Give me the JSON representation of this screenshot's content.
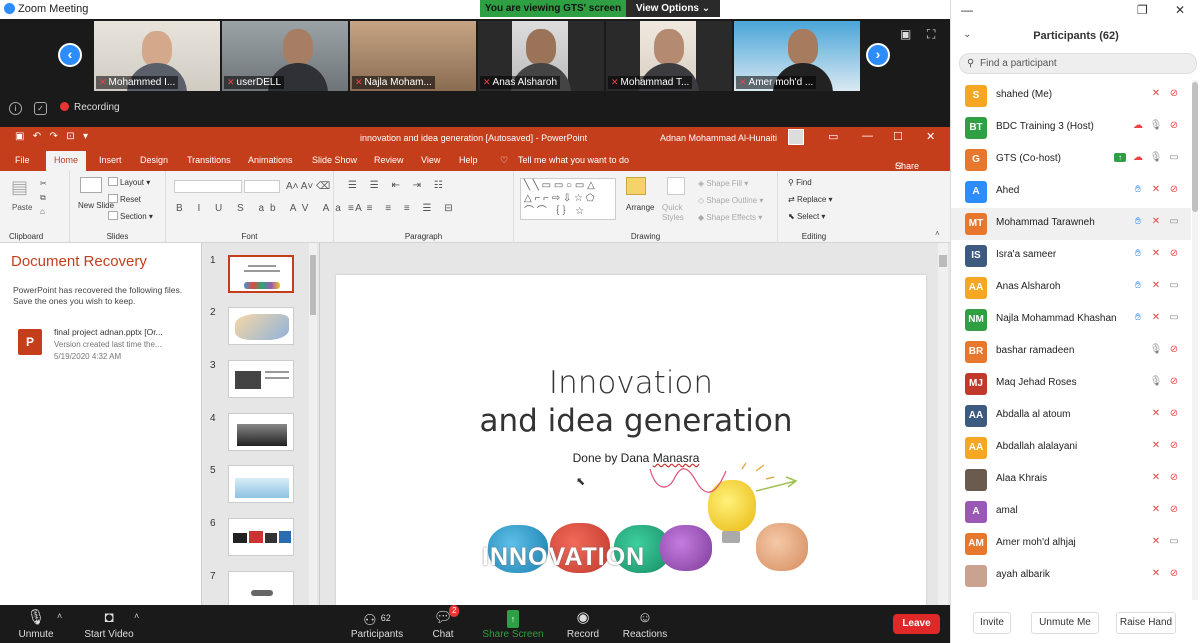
{
  "window": {
    "title": "Zoom Meeting"
  },
  "share_bar": {
    "viewing": "You are viewing GTS' screen",
    "options": "View Options"
  },
  "videos": [
    {
      "name": "Mohammed I..."
    },
    {
      "name": "userDELL"
    },
    {
      "name": "Najla Moham..."
    },
    {
      "name": "Anas Alsharoh"
    },
    {
      "name": "Mohammad T..."
    },
    {
      "name": "Amer moh'd ..."
    }
  ],
  "recording": {
    "label": "Recording"
  },
  "ppt": {
    "doc_title": "innovation and idea generation [Autosaved] - PowerPoint",
    "user": "Adnan Mohammad Al-Hunaiti",
    "tabs": [
      "File",
      "Home",
      "Insert",
      "Design",
      "Transitions",
      "Animations",
      "Slide Show",
      "Review",
      "View",
      "Help",
      "Tell me what you want to do",
      "Share"
    ],
    "ribbon": {
      "paste": "Paste",
      "clipboard": "Clipboard",
      "new_slide": "New Slide",
      "layout": "Layout",
      "reset": "Reset",
      "section": "Section",
      "slides": "Slides",
      "font": "Font",
      "paragraph": "Paragraph",
      "arrange": "Arrange",
      "quick_styles": "Quick Styles",
      "shape_fill": "Shape Fill",
      "shape_outline": "Shape Outline",
      "shape_effects": "Shape Effects",
      "drawing": "Drawing",
      "find": "Find",
      "replace": "Replace",
      "select": "Select",
      "editing": "Editing"
    },
    "recovery": {
      "title": "Document Recovery",
      "desc": "PowerPoint has recovered the following files.  Save the ones you wish to keep.",
      "file_name": "final project adnan.pptx  [Or...",
      "file_version": "Version created last time the...",
      "file_date": "5/19/2020 4:32 AM"
    },
    "slide_numbers": [
      "1",
      "2",
      "3",
      "4",
      "5",
      "6",
      "7"
    ],
    "slide": {
      "title_line1": "Innovation",
      "title_line2": "and idea generation",
      "subtitle_pre": "Done by Dana ",
      "subtitle_name": "Manasra",
      "art_text": "INNOVATION"
    }
  },
  "toolbar": {
    "unmute": "Unmute",
    "start_video": "Start Video",
    "participants": "Participants",
    "participants_count": "62",
    "chat": "Chat",
    "chat_badge": "2",
    "share_screen": "Share Screen",
    "record": "Record",
    "reactions": "Reactions",
    "leave": "Leave"
  },
  "panel": {
    "title": "Participants (62)",
    "search_placeholder": "Find a participant",
    "participants": [
      {
        "initials": "S",
        "name": "shahed (Me)",
        "color": "#f5a623",
        "icons": [
          "mic-off",
          "video-off"
        ]
      },
      {
        "initials": "BT",
        "name": "BDC Training 3 (Host)",
        "color": "#2ea043",
        "icons": [
          "cloud-rec",
          "mic",
          "video-off"
        ]
      },
      {
        "initials": "G",
        "name": "GTS (Co-host)",
        "color": "#e8772e",
        "icons": [
          "share",
          "cloud-rec",
          "mic",
          "video"
        ]
      },
      {
        "initials": "A",
        "name": "Ahed",
        "color": "#2d8cff",
        "icons": [
          "hand",
          "mic-off",
          "video-off"
        ]
      },
      {
        "initials": "MT",
        "name": "Mohammad Tarawneh",
        "color": "#e8772e",
        "icons": [
          "hand",
          "mic-off",
          "video"
        ]
      },
      {
        "initials": "IS",
        "name": "Isra'a sameer",
        "color": "#3d5a80",
        "icons": [
          "hand",
          "mic-off",
          "video-off"
        ]
      },
      {
        "initials": "AA",
        "name": "Anas Alsharoh",
        "color": "#f5a623",
        "icons": [
          "hand",
          "mic-off",
          "video"
        ]
      },
      {
        "initials": "NM",
        "name": "Najla Mohammad Khashan",
        "color": "#2ea043",
        "icons": [
          "hand",
          "mic-off",
          "video"
        ]
      },
      {
        "initials": "BR",
        "name": "bashar ramadeen",
        "color": "#e8772e",
        "icons": [
          "mic",
          "video-off"
        ]
      },
      {
        "initials": "MJ",
        "name": "Maq Jehad Roses",
        "color": "#c0392b",
        "icons": [
          "mic",
          "video-off"
        ]
      },
      {
        "initials": "AA",
        "name": "Abdalla al atoum",
        "color": "#3d5a80",
        "icons": [
          "mic-off",
          "video-off"
        ]
      },
      {
        "initials": "AA",
        "name": "Abdallah alalayani",
        "color": "#f5a623",
        "icons": [
          "mic-off",
          "video-off"
        ]
      },
      {
        "initials": "",
        "name": "Alaa Khrais",
        "color": "#6b5a4e",
        "icons": [
          "mic-off",
          "video-off"
        ]
      },
      {
        "initials": "A",
        "name": "amal",
        "color": "#9b59b6",
        "icons": [
          "mic-off",
          "video-off"
        ]
      },
      {
        "initials": "AM",
        "name": "Amer moh'd alhjaj",
        "color": "#e8772e",
        "icons": [
          "mic-off",
          "video"
        ]
      },
      {
        "initials": "",
        "name": "ayah albarik",
        "color": "#c9a38f",
        "icons": [
          "mic-off",
          "video-off"
        ]
      }
    ],
    "invite": "Invite",
    "unmute_me": "Unmute Me",
    "raise_hand": "Raise Hand"
  }
}
